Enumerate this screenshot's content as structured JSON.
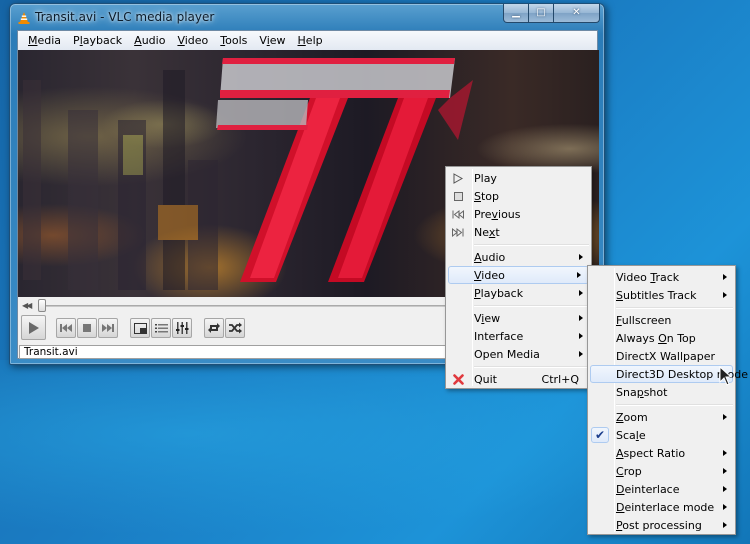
{
  "window": {
    "title": "Transit.avi - VLC media player",
    "icon": "vlc-cone-icon",
    "caption_buttons": [
      {
        "name": "minimize",
        "glyph": "▁"
      },
      {
        "name": "maximize",
        "glyph": "□"
      },
      {
        "name": "close",
        "glyph": "✕"
      }
    ]
  },
  "menubar": {
    "items": [
      {
        "label": "Media",
        "accel": "M"
      },
      {
        "label": "Playback",
        "accel": "l"
      },
      {
        "label": "Audio",
        "accel": "A"
      },
      {
        "label": "Video",
        "accel": "V"
      },
      {
        "label": "Tools",
        "accel": "T"
      },
      {
        "label": "View",
        "accel": "i"
      },
      {
        "label": "Help",
        "accel": "H"
      }
    ]
  },
  "video": {
    "description": "City night skyline with large chrome-and-red '77' logo"
  },
  "seek": {
    "position_fraction": 0.0,
    "icon": "seek-back-icon"
  },
  "controls": {
    "buttons": [
      {
        "name": "play",
        "icon": "play-icon"
      },
      {
        "name": "previous",
        "icon": "previous-icon"
      },
      {
        "name": "stop",
        "icon": "stop-icon"
      },
      {
        "name": "next",
        "icon": "next-icon"
      },
      {
        "name": "fullscreen",
        "icon": "fullscreen-icon"
      },
      {
        "name": "playlist",
        "icon": "playlist-icon"
      },
      {
        "name": "extended-settings",
        "icon": "equalizer-icon"
      },
      {
        "name": "loop",
        "icon": "loop-icon"
      },
      {
        "name": "random",
        "icon": "shuffle-icon"
      }
    ]
  },
  "statusbar": {
    "text": "Transit.avi"
  },
  "context_menu": {
    "items": [
      {
        "label": "Play",
        "icon": "play-icon"
      },
      {
        "label": "Stop",
        "icon": "stop-icon"
      },
      {
        "label": "Previous",
        "icon": "previous-icon"
      },
      {
        "label": "Next",
        "icon": "next-icon"
      },
      {
        "separator": true
      },
      {
        "label": "Audio",
        "submenu": true
      },
      {
        "label": "Video",
        "submenu": true,
        "highlighted": true
      },
      {
        "label": "Playback",
        "submenu": true
      },
      {
        "separator": true
      },
      {
        "label": "View",
        "submenu": true
      },
      {
        "label": "Interface",
        "submenu": true
      },
      {
        "label": "Open Media",
        "submenu": true
      },
      {
        "separator": true
      },
      {
        "label": "Quit",
        "shortcut": "Ctrl+Q",
        "icon": "quit-icon"
      }
    ]
  },
  "video_submenu": {
    "items": [
      {
        "label": "Video Track",
        "submenu": true
      },
      {
        "label": "Subtitles Track",
        "submenu": true
      },
      {
        "separator": true
      },
      {
        "label": "Fullscreen"
      },
      {
        "label": "Always On Top"
      },
      {
        "label": "DirectX Wallpaper"
      },
      {
        "label": "Direct3D Desktop mode",
        "highlighted": true
      },
      {
        "label": "Snapshot"
      },
      {
        "separator": true
      },
      {
        "label": "Zoom",
        "submenu": true
      },
      {
        "label": "Scale",
        "checked": true
      },
      {
        "label": "Aspect Ratio",
        "submenu": true
      },
      {
        "label": "Crop",
        "submenu": true
      },
      {
        "label": "Deinterlace",
        "submenu": true
      },
      {
        "label": "Deinterlace mode",
        "submenu": true
      },
      {
        "label": "Post processing",
        "submenu": true
      }
    ]
  },
  "colors": {
    "desktop": "#1a7bc2",
    "titlebar": "#3a8cc6",
    "menu_bg": "#f0f0f0",
    "highlight_border": "#aecbf0",
    "logo_red": "#d0102a",
    "quit_red": "#e0393e"
  }
}
